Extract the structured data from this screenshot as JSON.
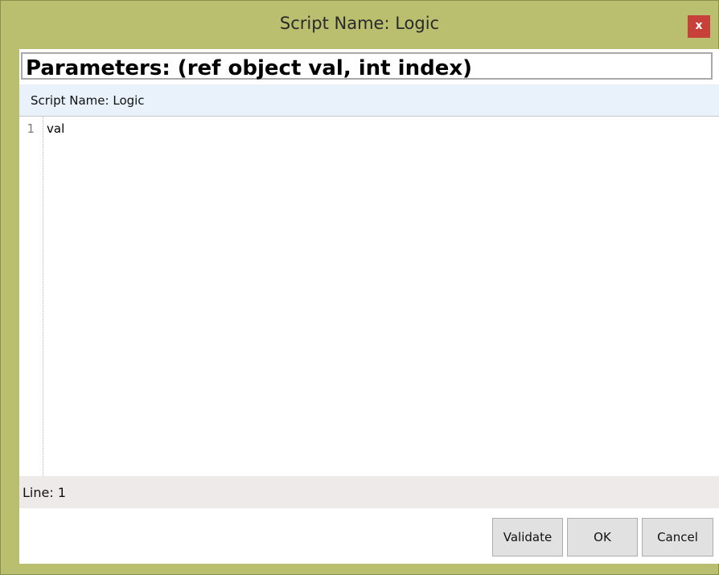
{
  "window": {
    "title": "Script Name: Logic",
    "close_glyph": "x"
  },
  "parameters": {
    "text": "Parameters: (ref object val, int index)"
  },
  "script_header": {
    "text": "Script Name: Logic"
  },
  "editor": {
    "lines": [
      {
        "number": "1",
        "code": "val"
      }
    ]
  },
  "status": {
    "text": "Line: 1"
  },
  "buttons": {
    "validate": "Validate",
    "ok": "OK",
    "cancel": "Cancel"
  },
  "icons": {
    "close": "close-icon"
  },
  "colors": {
    "frame": "#b9bf6f",
    "close_button": "#c7403a",
    "script_header_bg": "#e9f1fb",
    "status_bg": "#eeeaea",
    "button_bg": "#e1e1e1"
  }
}
